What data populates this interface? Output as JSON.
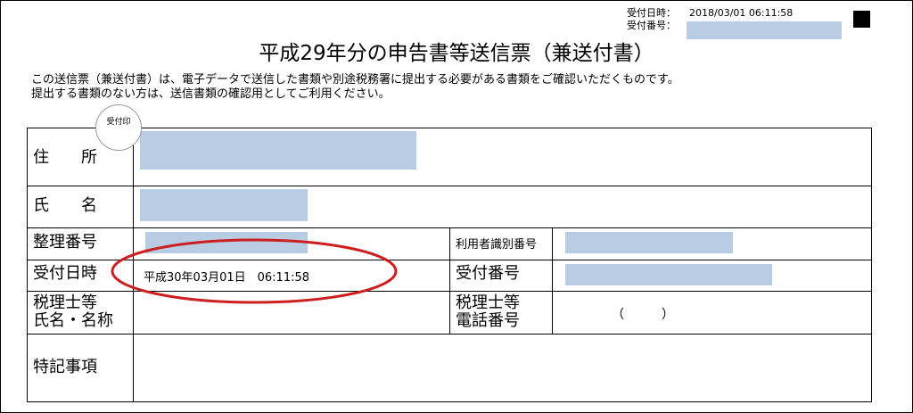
{
  "receipt": {
    "datetime_label": "受付日時：",
    "datetime_value": "2018/03/01 06:11:58",
    "number_label": "受付番号："
  },
  "title": "平成29年分の申告書等送信票（兼送付書）",
  "intro": {
    "line1": "この送信票（兼送付書）は、電子データで送信した書類や別途税務署に提出する必要がある書類をご確認いただくものです。",
    "line2": "提出する書類のない方は、送信書類の確認用としてご利用ください。"
  },
  "stamp": "受付印",
  "form": {
    "address_label": "住　　所",
    "name_label": "氏　　名",
    "ref_number_label": "整理番号",
    "user_id_label": "利用者識別番号",
    "recv_datetime_label": "受付日時",
    "recv_datetime_value": "平成30年03月01日　06:11:58",
    "recv_number_label": "受付番号",
    "tax_accountant_label_1": "税理士等",
    "tax_accountant_label_2": "氏名・名称",
    "phone_label_1": "税理士等",
    "phone_label_2": "電話番号",
    "phone_parens": "（　　　）",
    "notes_label": "特記事項"
  },
  "colors": {
    "redaction": "#b8cce4",
    "highlight_ellipse": "#cc1f1f"
  }
}
